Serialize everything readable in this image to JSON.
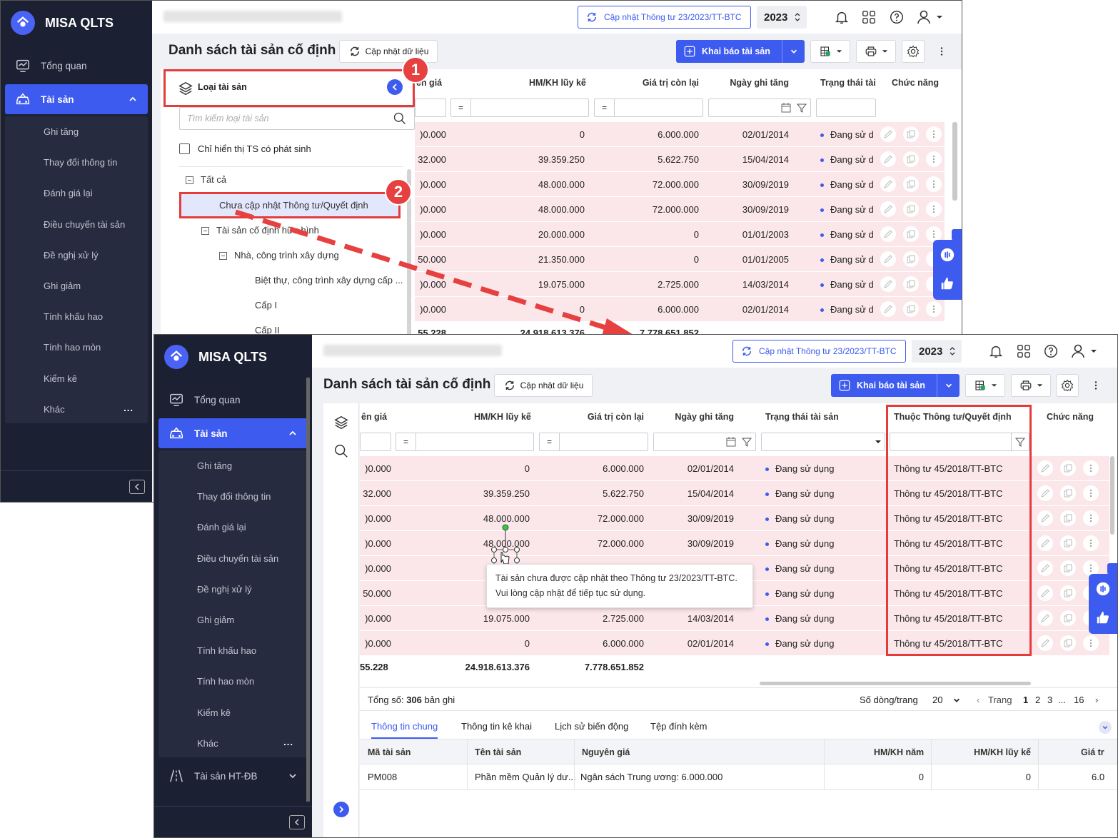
{
  "app": {
    "name": "MISA QLTS"
  },
  "sidebar": {
    "items": {
      "overview": "Tổng quan",
      "assets": "Tài sản",
      "infra": "Tài sản HT-ĐB"
    },
    "sub": [
      "Ghi tăng",
      "Thay đổi thông tin",
      "Đánh giá lại",
      "Điều chuyển tài sản",
      "Đề nghị xử lý",
      "Ghi giảm",
      "Tính khấu hao",
      "Tính hao mòn",
      "Kiểm kê",
      "Khác"
    ],
    "more_label": "..."
  },
  "topbar": {
    "update_label": "Cập nhật Thông tư 23/2023/TT-BTC",
    "year": "2023"
  },
  "page": {
    "title": "Danh sách tài sản cố định",
    "refresh_label": "Cập nhật dữ liệu",
    "declare_label": "Khai báo tài sản"
  },
  "filter_panel": {
    "title": "Loại tài sản",
    "search_placeholder": "Tìm kiếm loại tài sản",
    "only_changed_label": "Chỉ hiển thị TS có phát sinh",
    "tree": [
      "Tất cả",
      "Chưa cập nhật Thông tư/Quyết định",
      "Tài sản cố định hữu hình",
      "Nhà, công trình xây dựng",
      "Biệt thự, công trình xây dựng cấp ...",
      "Cấp I",
      "Cấp II"
    ]
  },
  "columns": {
    "cost": "ên giá",
    "accum": "HM/KH lũy kế",
    "remain": "Giá trị còn lại",
    "date": "Ngày ghi tăng",
    "status_short": "Trạng thái tài",
    "status": "Trạng thái tài sản",
    "circular": "Thuộc Thông tư/Quyết định",
    "func": "Chức năng"
  },
  "filter_eq": "=",
  "rows_top": [
    {
      "cost": ")0.000",
      "accum": "0",
      "remain": "6.000.000",
      "date": "02/01/2014",
      "status": "Đang sử d"
    },
    {
      "cost": "32.000",
      "accum": "39.359.250",
      "remain": "5.622.750",
      "date": "15/04/2014",
      "status": "Đang sử d"
    },
    {
      "cost": ")0.000",
      "accum": "48.000.000",
      "remain": "72.000.000",
      "date": "30/09/2019",
      "status": "Đang sử d"
    },
    {
      "cost": ")0.000",
      "accum": "48.000.000",
      "remain": "72.000.000",
      "date": "30/09/2019",
      "status": "Đang sử d"
    },
    {
      "cost": ")0.000",
      "accum": "20.000.000",
      "remain": "0",
      "date": "01/01/2003",
      "status": "Đang sử d"
    },
    {
      "cost": "50.000",
      "accum": "21.350.000",
      "remain": "0",
      "date": "01/01/2005",
      "status": "Đang sử d"
    },
    {
      "cost": ")0.000",
      "accum": "19.075.000",
      "remain": "2.725.000",
      "date": "14/03/2014",
      "status": "Đang sử d"
    },
    {
      "cost": ")0.000",
      "accum": "0",
      "remain": "6.000.000",
      "date": "02/01/2014",
      "status": "Đang sử d"
    }
  ],
  "totals_top": {
    "cost": "55.228",
    "accum": "24.918.613.376",
    "remain": "7.778.651.852"
  },
  "rows_bottom": [
    {
      "cost": ")0.000",
      "accum": "0",
      "remain": "6.000.000",
      "date": "02/01/2014",
      "status": "Đang sử dụng",
      "circular": "Thông tư 45/2018/TT-BTC"
    },
    {
      "cost": "32.000",
      "accum": "39.359.250",
      "remain": "5.622.750",
      "date": "15/04/2014",
      "status": "Đang sử dụng",
      "circular": "Thông tư 45/2018/TT-BTC"
    },
    {
      "cost": ")0.000",
      "accum": "48.000.000",
      "remain": "72.000.000",
      "date": "30/09/2019",
      "status": "Đang sử dụng",
      "circular": "Thông tư 45/2018/TT-BTC"
    },
    {
      "cost": ")0.000",
      "accum": "48.000.000",
      "remain": "72.000.000",
      "date": "30/09/2019",
      "status": "Đang sử dụng",
      "circular": "Thông tư 45/2018/TT-BTC"
    },
    {
      "cost": ")0.000",
      "accum": "2",
      "remain": "",
      "date": "",
      "status": "Đang sử dụng",
      "circular": "Thông tư 45/2018/TT-BTC"
    },
    {
      "cost": "50.000",
      "accum": "2",
      "remain": "",
      "date": "",
      "status": "Đang sử dụng",
      "circular": "Thông tư 45/2018/TT-BTC"
    },
    {
      "cost": ")0.000",
      "accum": "19.075.000",
      "remain": "2.725.000",
      "date": "14/03/2014",
      "status": "Đang sử dụng",
      "circular": "Thông tư 45/2018/TT-BTC"
    },
    {
      "cost": ")0.000",
      "accum": "0",
      "remain": "6.000.000",
      "date": "02/01/2014",
      "status": "Đang sử dụng",
      "circular": "Thông tư 45/2018/TT-BTC"
    }
  ],
  "totals_bottom": {
    "cost": "55.228",
    "accum": "24.918.613.376",
    "remain": "7.778.651.852"
  },
  "tooltip": {
    "line1": "Tài sản chưa được cập nhật theo Thông tư 23/2023/TT-BTC.",
    "line2": "Vui lòng cập nhật để tiếp tục sử dụng."
  },
  "pager": {
    "total_label": "Tổng số:",
    "total_value": "306",
    "total_unit": "bản ghi",
    "per_page_label": "Số dòng/trang",
    "per_page": "20",
    "page_label": "Trang",
    "pages": [
      "1",
      "2",
      "3",
      "...",
      "16"
    ]
  },
  "detail": {
    "tabs": [
      "Thông tin chung",
      "Thông tin kê khai",
      "Lịch sử biến động",
      "Tệp đính kèm"
    ],
    "headers": [
      "Mã tài sản",
      "Tên tài sản",
      "Nguyên giá",
      "HM/KH năm",
      "HM/KH lũy kế",
      "Giá tr"
    ],
    "row": [
      "PM008",
      "Phần mềm Quản lý dư...",
      "Ngân sách Trung ương: 6.000.000",
      "0",
      "0",
      "6.0"
    ]
  },
  "badges": [
    "1",
    "2"
  ],
  "colors": {
    "accent": "#3e5bef",
    "sidebar": "#1c2033",
    "highlight": "#e53b3b",
    "row": "#fbe7ea"
  }
}
